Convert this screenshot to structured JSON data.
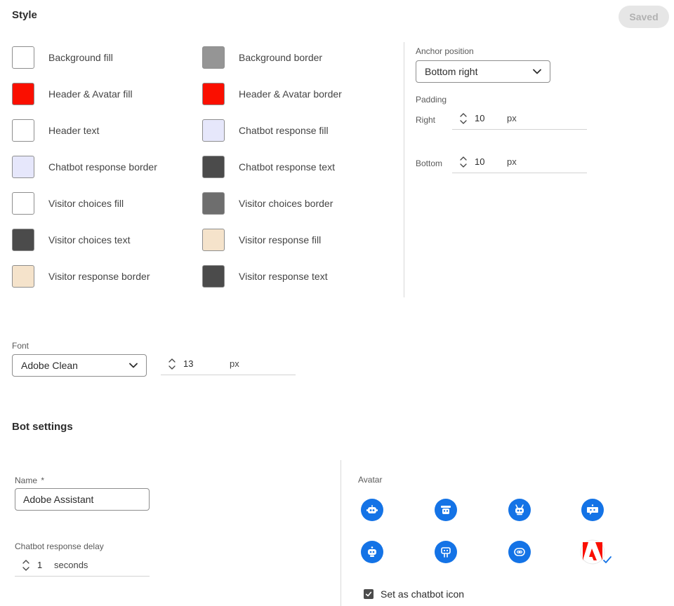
{
  "style": {
    "title": "Style",
    "saved_label": "Saved",
    "colors_left": [
      {
        "label": "Background fill",
        "color": "#ffffff"
      },
      {
        "label": "Header & Avatar fill",
        "color": "#fa0f00"
      },
      {
        "label": "Header text",
        "color": "#ffffff"
      },
      {
        "label": "Chatbot response border",
        "color": "#e6e7fb"
      },
      {
        "label": "Visitor choices fill",
        "color": "#ffffff"
      },
      {
        "label": "Visitor choices text",
        "color": "#4b4b4b"
      },
      {
        "label": "Visitor response border",
        "color": "#f5e3cb"
      }
    ],
    "colors_right": [
      {
        "label": "Background border",
        "color": "#959595"
      },
      {
        "label": "Header & Avatar border",
        "color": "#fa0f00"
      },
      {
        "label": "Chatbot response fill",
        "color": "#e6e7fb"
      },
      {
        "label": "Chatbot response text",
        "color": "#4b4b4b"
      },
      {
        "label": "Visitor choices border",
        "color": "#6e6e6e"
      },
      {
        "label": "Visitor response fill",
        "color": "#f5e3cb"
      },
      {
        "label": "Visitor response text",
        "color": "#4b4b4b"
      }
    ],
    "anchor": {
      "label": "Anchor position",
      "value": "Bottom right"
    },
    "padding": {
      "label": "Padding",
      "right": {
        "label": "Right",
        "value": "10",
        "unit": "px"
      },
      "bottom": {
        "label": "Bottom",
        "value": "10",
        "unit": "px"
      }
    },
    "font": {
      "label": "Font",
      "value": "Adobe Clean",
      "size": "13",
      "unit": "px"
    }
  },
  "bot": {
    "title": "Bot settings",
    "name_label": "Name",
    "name_required": "*",
    "name_value": "Adobe Assistant",
    "delay_label": "Chatbot response delay",
    "delay_value": "1",
    "delay_unit": "seconds",
    "avatar_label": "Avatar",
    "avatars": [
      "robot-icon",
      "robot-hat-icon",
      "robot-antenna-icon",
      "robot-chat-icon",
      "robot-square-icon",
      "robot-tall-icon",
      "robot-face-icon",
      "adobe-logo-icon"
    ],
    "avatar_color": "#1473e6",
    "set_icon_label": "Set as chatbot icon",
    "set_icon_checked": true
  }
}
